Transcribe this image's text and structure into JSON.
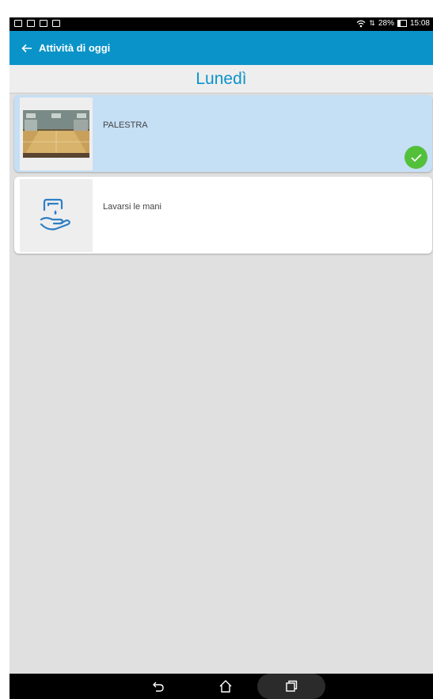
{
  "status_bar": {
    "battery_text": "28%",
    "time": "15:08"
  },
  "app_bar": {
    "title": "Attività di oggi",
    "back_icon": "arrow-left-icon",
    "background": "#0a93c9"
  },
  "day_header": {
    "label": "Lunedì",
    "color": "#0a93c9"
  },
  "activities": [
    {
      "label": "PALESTRA",
      "completed": true,
      "thumb_icon": "gym-photo",
      "background": "#c5dff5"
    },
    {
      "label": "Lavarsi le mani",
      "completed": false,
      "thumb_icon": "hand-wash-icon",
      "background": "#ffffff"
    }
  ],
  "colors": {
    "check": "#53c03b",
    "list_background": "#e0e0e0"
  },
  "nav_bar": {
    "icons": [
      "back-nav-icon",
      "home-nav-icon",
      "recent-apps-icon"
    ]
  }
}
